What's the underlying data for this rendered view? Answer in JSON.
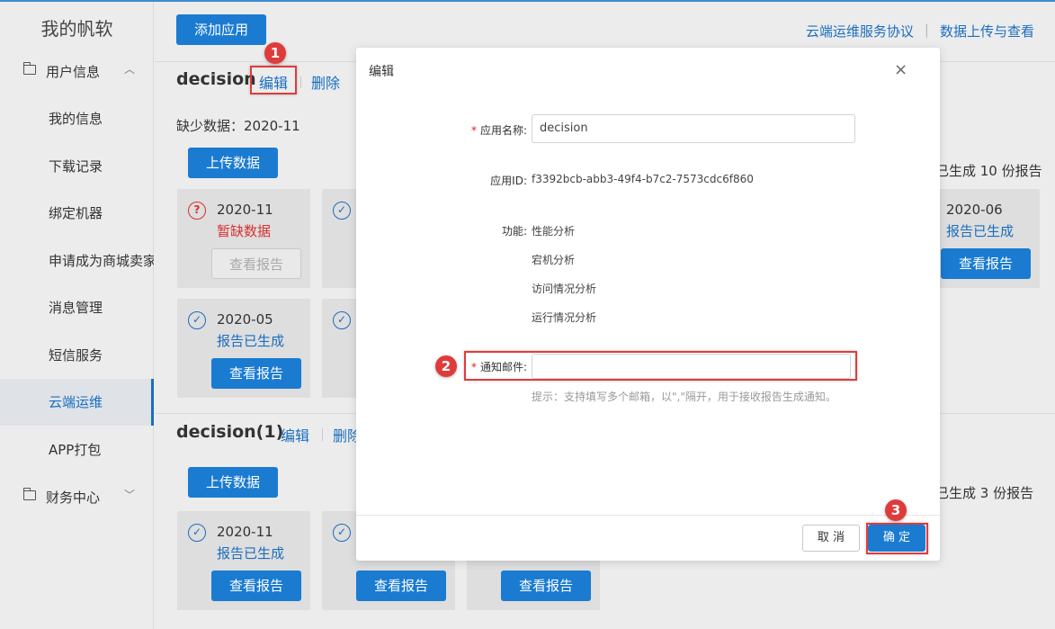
{
  "sidebar": {
    "brand": "我的帆软",
    "groups": [
      {
        "label": "用户信息",
        "icon": "folder-icon",
        "chevron": "expanded"
      },
      {
        "label": "财务中心",
        "icon": "folder-icon",
        "chevron": "collapsed"
      }
    ],
    "items": [
      {
        "label": "我的信息"
      },
      {
        "label": "下载记录"
      },
      {
        "label": "绑定机器"
      },
      {
        "label": "申请成为商城卖家"
      },
      {
        "label": "消息管理"
      },
      {
        "label": "短信服务"
      },
      {
        "label": "云端运维",
        "active": true
      },
      {
        "label": "APP打包"
      }
    ]
  },
  "header": {
    "add_app_label": "添加应用",
    "links": [
      "云端运维服务协议",
      "数据上传与查看"
    ]
  },
  "apps": [
    {
      "name": "decision",
      "edit_label": "编辑",
      "delete_label": "删除",
      "missing_label": "缺少数据：2020-11",
      "upload_label": "上传数据",
      "report_count": "已生成 10 份报告",
      "cards": [
        {
          "month": "2020-11",
          "status": "暂缺数据",
          "button": "查看报告",
          "state": "missing"
        },
        {
          "month": "2020-06",
          "status": "报告已生成",
          "button": "查看报告",
          "state": "done"
        },
        {
          "month": "2020-05",
          "status": "报告已生成",
          "button": "查看报告",
          "state": "done"
        }
      ]
    },
    {
      "name": "decision(1)",
      "edit_label": "编辑",
      "delete_label": "删除",
      "upload_label": "上传数据",
      "report_count": "已生成 3 份报告",
      "cards": [
        {
          "month": "2020-11",
          "status": "报告已生成",
          "button": "查看报告",
          "state": "done"
        },
        {
          "button": "查看报告"
        },
        {
          "button": "查看报告"
        }
      ]
    }
  ],
  "modal": {
    "title": "编辑",
    "close_glyph": "×",
    "app_name_label": "应用名称:",
    "app_name_value": "decision",
    "app_id_label": "应用ID:",
    "app_id_value": "f3392bcb-abb3-49f4-b7c2-7573cdc6f860",
    "features_label": "功能:",
    "features": [
      "性能分析",
      "宕机分析",
      "访问情况分析",
      "运行情况分析"
    ],
    "email_label": "通知邮件:",
    "email_value": "",
    "email_hint": "提示：支持填写多个邮箱，以\",\"隔开，用于接收报告生成通知。",
    "cancel_label": "取 消",
    "ok_label": "确 定"
  },
  "annotations": [
    "1",
    "2",
    "3"
  ],
  "colors": {
    "accent": "#1a7bd1",
    "link": "#1a6ebf",
    "warning": "#d93030",
    "highlight": "#e03b3b"
  }
}
